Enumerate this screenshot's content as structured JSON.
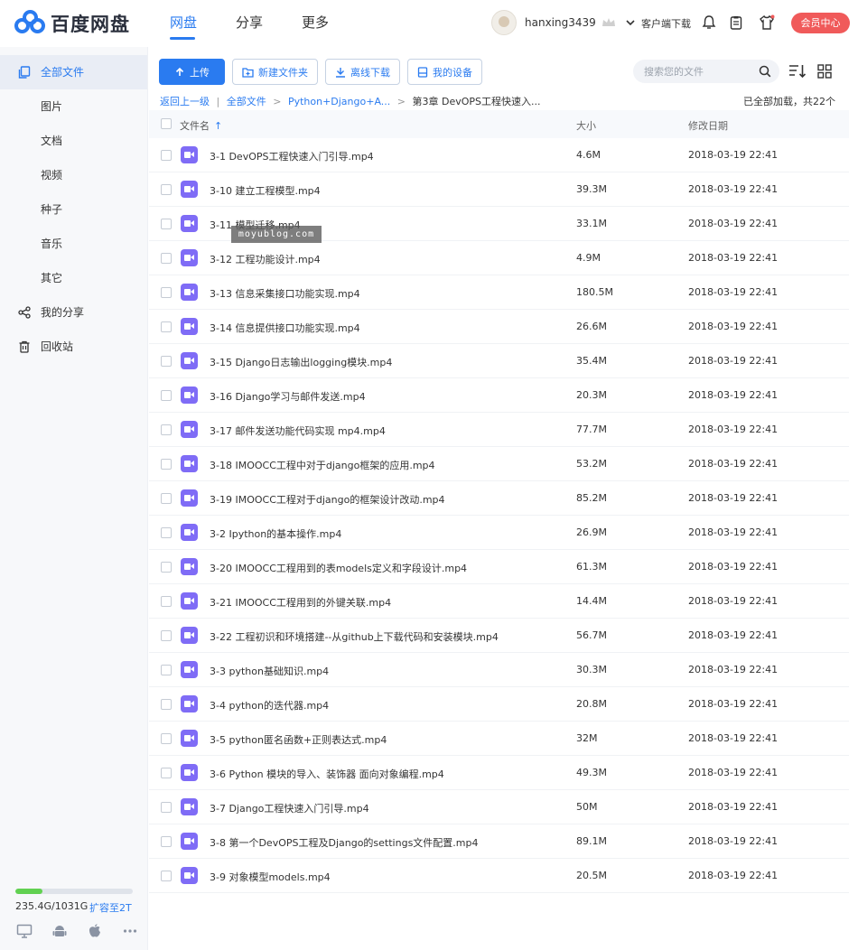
{
  "app": {
    "name": "百度网盘"
  },
  "nav": [
    {
      "label": "网盘",
      "active": true
    },
    {
      "label": "分享",
      "active": false
    },
    {
      "label": "更多",
      "active": false
    }
  ],
  "user": {
    "name": "hanxing3439"
  },
  "header": {
    "client_download": "客户端下载",
    "vip_center": "会员中心"
  },
  "sidebar": {
    "items": [
      {
        "label": "全部文件",
        "active": true
      },
      {
        "label": "图片"
      },
      {
        "label": "文档"
      },
      {
        "label": "视频"
      },
      {
        "label": "种子"
      },
      {
        "label": "音乐"
      },
      {
        "label": "其它"
      },
      {
        "label": "我的分享"
      },
      {
        "label": "回收站"
      }
    ],
    "quota": {
      "text": "235.4G/1031G",
      "used_fraction": 0.228,
      "expand": "扩容至2T"
    }
  },
  "toolbar": {
    "upload": "上传",
    "new_folder": "新建文件夹",
    "offline_download": "离线下载",
    "my_devices": "我的设备"
  },
  "search": {
    "placeholder": "搜索您的文件"
  },
  "breadcrumb": {
    "back": "返回上一级",
    "sep": "|",
    "root": "全部文件",
    "parent": "Python+Django+A...",
    "current": "第3章 DevOPS工程快速入..."
  },
  "load_status": "已全部加载，共22个",
  "table": {
    "headers": {
      "name": "文件名",
      "size": "大小",
      "date": "修改日期"
    },
    "rows": [
      {
        "name": "3-1 DevOPS工程快速入门引导.mp4",
        "size": "4.6M",
        "date": "2018-03-19 22:41"
      },
      {
        "name": "3-10 建立工程模型.mp4",
        "size": "39.3M",
        "date": "2018-03-19 22:41"
      },
      {
        "name": "3-11 模型迁移.mp4",
        "size": "33.1M",
        "date": "2018-03-19 22:41"
      },
      {
        "name": "3-12 工程功能设计.mp4",
        "size": "4.9M",
        "date": "2018-03-19 22:41"
      },
      {
        "name": "3-13 信息采集接口功能实现.mp4",
        "size": "180.5M",
        "date": "2018-03-19 22:41"
      },
      {
        "name": "3-14 信息提供接口功能实现.mp4",
        "size": "26.6M",
        "date": "2018-03-19 22:41"
      },
      {
        "name": "3-15 Django日志输出logging模块.mp4",
        "size": "35.4M",
        "date": "2018-03-19 22:41"
      },
      {
        "name": "3-16 Django学习与邮件发送.mp4",
        "size": "20.3M",
        "date": "2018-03-19 22:41"
      },
      {
        "name": "3-17 邮件发送功能代码实现 mp4.mp4",
        "size": "77.7M",
        "date": "2018-03-19 22:41"
      },
      {
        "name": "3-18 IMOOCC工程中对于django框架的应用.mp4",
        "size": "53.2M",
        "date": "2018-03-19 22:41"
      },
      {
        "name": "3-19 IMOOCC工程对于django的框架设计改动.mp4",
        "size": "85.2M",
        "date": "2018-03-19 22:41"
      },
      {
        "name": "3-2 Ipython的基本操作.mp4",
        "size": "26.9M",
        "date": "2018-03-19 22:41"
      },
      {
        "name": "3-20 IMOOCC工程用到的表models定义和字段设计.mp4",
        "size": "61.3M",
        "date": "2018-03-19 22:41"
      },
      {
        "name": "3-21 IMOOCC工程用到的外键关联.mp4",
        "size": "14.4M",
        "date": "2018-03-19 22:41"
      },
      {
        "name": "3-22 工程初识和环境搭建--从github上下载代码和安装模块.mp4",
        "size": "56.7M",
        "date": "2018-03-19 22:41"
      },
      {
        "name": "3-3 python基础知识.mp4",
        "size": "30.3M",
        "date": "2018-03-19 22:41"
      },
      {
        "name": "3-4 python的迭代器.mp4",
        "size": "20.8M",
        "date": "2018-03-19 22:41"
      },
      {
        "name": "3-5 python匿名函数+正则表达式.mp4",
        "size": "32M",
        "date": "2018-03-19 22:41"
      },
      {
        "name": "3-6 Python 模块的导入、装饰器 面向对象编程.mp4",
        "size": "49.3M",
        "date": "2018-03-19 22:41"
      },
      {
        "name": "3-7 Django工程快速入门引导.mp4",
        "size": "50M",
        "date": "2018-03-19 22:41"
      },
      {
        "name": "3-8 第一个DevOPS工程及Django的settings文件配置.mp4",
        "size": "89.1M",
        "date": "2018-03-19 22:41"
      },
      {
        "name": "3-9 对象模型models.mp4",
        "size": "20.5M",
        "date": "2018-03-19 22:41"
      }
    ]
  },
  "watermark": "moyublog.com",
  "colors": {
    "accent": "#2a7bf0",
    "vip": "#f05a5a",
    "quota": "#61d151",
    "video_icon": "#7f6cf6"
  }
}
